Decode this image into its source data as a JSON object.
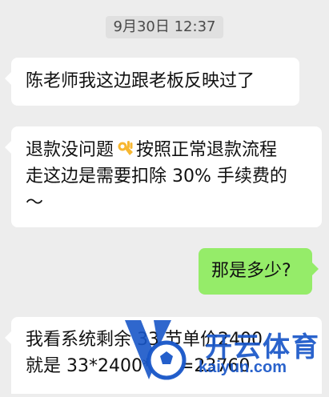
{
  "timestamp": "9月30日 12:37",
  "messages": [
    {
      "side": "left",
      "lines": [
        "陈老师我这边跟老板反映过了"
      ]
    },
    {
      "side": "left",
      "line1_before": "退款没问题",
      "emoji": "ok-hand-icon",
      "line1_after": "按照正常退款流程",
      "line2": "走这边是需要扣除 30% 手续费的",
      "line3": "～"
    },
    {
      "side": "right",
      "text": "那是多少?"
    },
    {
      "side": "left",
      "line1": "我看系统剩余 33 节单价2400",
      "line2": "就是 33*2400*0.3=23760"
    }
  ],
  "watermark": {
    "brand": "开云体育",
    "url": "kaiyun.com"
  },
  "colors": {
    "background": "#ededed",
    "incoming_bubble": "#ffffff",
    "outgoing_bubble": "#95ec69",
    "watermark_blue": "#1856c8"
  }
}
